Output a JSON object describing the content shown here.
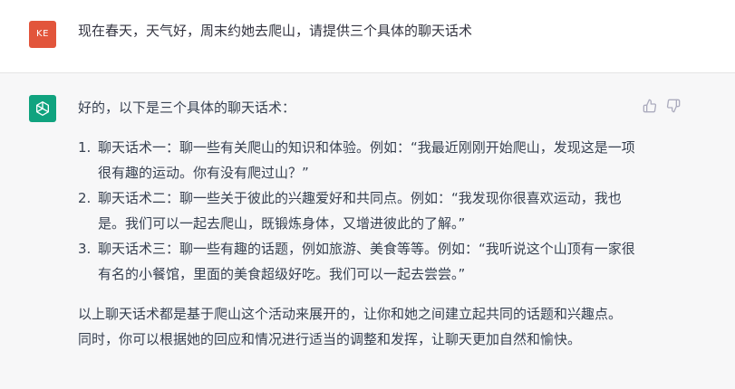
{
  "user": {
    "avatar_text": "KE",
    "message": "现在春天，天气好，周末约她去爬山，请提供三个具体的聊天话术"
  },
  "assistant": {
    "avatar_icon": "openai-logo-icon",
    "intro": "好的，以下是三个具体的聊天话术：",
    "items": [
      {
        "number": "1.",
        "line1": "聊天话术一：聊一些有关爬山的知识和体验。例如：“我最近刚刚开始爬山，发现这是一项",
        "line2": "很有趣的运动。你有没有爬过山？”"
      },
      {
        "number": "2.",
        "line1": "聊天话术二：聊一些关于彼此的兴趣爱好和共同点。例如：“我发现你很喜欢运动，我也",
        "line2": "是。我们可以一起去爬山，既锻炼身体，又增进彼此的了解。”"
      },
      {
        "number": "3.",
        "line1": "聊天话术三：聊一些有趣的话题，例如旅游、美食等等。例如：“我听说这个山顶有一家很",
        "line2": "有名的小餐馆，里面的美食超级好吃。我们可以一起去尝尝。”"
      }
    ],
    "conclusion_line1": "以上聊天话术都是基于爬山这个活动来展开的，让你和她之间建立起共同的话题和兴趣点。",
    "conclusion_line2": "同时，你可以根据她的回应和情况进行适当的调整和发挥，让聊天更加自然和愉快。"
  },
  "feedback": {
    "thumbs_up_icon": "thumbs-up-icon",
    "thumbs_down_icon": "thumbs-down-icon"
  },
  "colors": {
    "user_avatar": "#e2553b",
    "bot_avatar": "#10a37f",
    "assistant_bg": "#f7f7f8"
  }
}
